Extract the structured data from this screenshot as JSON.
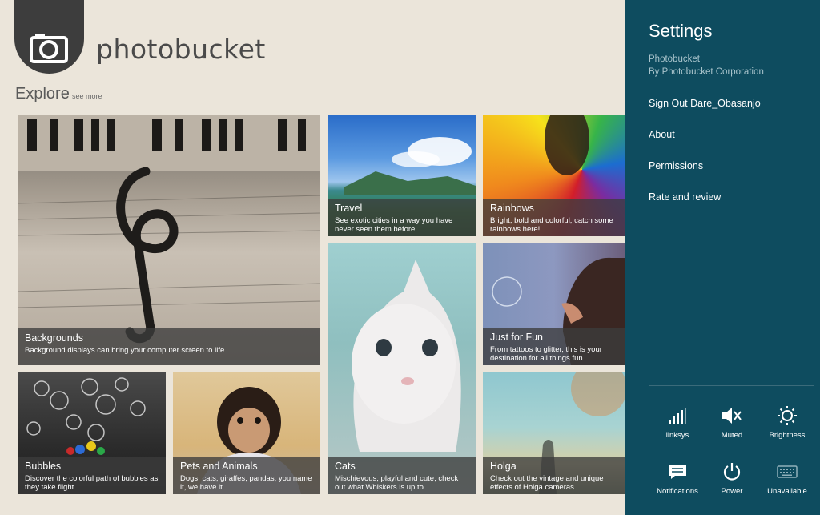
{
  "app": {
    "brand": "photobucket",
    "section_title": "Explore",
    "see_more": "see more"
  },
  "tiles": [
    {
      "title": "Backgrounds",
      "desc": "Background displays can bring your computer screen to life."
    },
    {
      "title": "Travel",
      "desc": "See exotic cities in a way you have never seen them before..."
    },
    {
      "title": "Rainbows",
      "desc": "Bright, bold and colorful, catch some rainbows here!"
    },
    {
      "title": "Cats",
      "desc": "Mischievous, playful and cute, check out what Whiskers is up to..."
    },
    {
      "title": "Just for Fun",
      "desc": "From tattoos to glitter, this is your destination for all things fun."
    },
    {
      "title": "Bubbles",
      "desc": "Discover the colorful path of bubbles as they take flight..."
    },
    {
      "title": "Pets and Animals",
      "desc": "Dogs, cats, giraffes, pandas, you name it, we have it."
    },
    {
      "title": "Holga",
      "desc": "Check out the vintage and unique effects of Holga cameras."
    }
  ],
  "charm": {
    "title": "Settings",
    "app_name": "Photobucket",
    "publisher": "By Photobucket Corporation",
    "items": [
      "Sign Out Dare_Obasanjo",
      "About",
      "Permissions",
      "Rate and review"
    ],
    "quick": [
      {
        "label": "linksys",
        "icon": "network-icon"
      },
      {
        "label": "Muted",
        "icon": "volume-muted-icon"
      },
      {
        "label": "Brightness",
        "icon": "brightness-icon"
      },
      {
        "label": "Notifications",
        "icon": "notifications-icon"
      },
      {
        "label": "Power",
        "icon": "power-icon"
      },
      {
        "label": "Unavailable",
        "icon": "keyboard-icon"
      }
    ]
  }
}
